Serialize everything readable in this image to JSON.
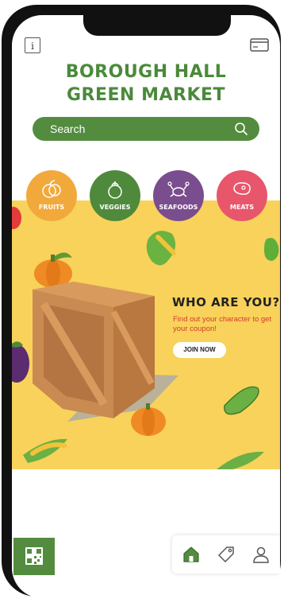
{
  "header": {
    "info_label": "i",
    "title_line1": "BOROUGH HALL",
    "title_line2": "GREEN MARKET",
    "card_icon": "credit-card-icon"
  },
  "search": {
    "placeholder": "Search",
    "icon": "search-icon"
  },
  "categories": [
    {
      "label": "FRUITS",
      "color": "#f2a93b",
      "icon": "fruit-icon"
    },
    {
      "label": "VEGGIES",
      "color": "#4f8a3c",
      "icon": "vegetable-icon"
    },
    {
      "label": "SEAFOODS",
      "color": "#7a4d8e",
      "icon": "crab-icon"
    },
    {
      "label": "MEATS",
      "color": "#e8566c",
      "icon": "steak-icon"
    }
  ],
  "promo": {
    "heading": "WHO ARE YOU?",
    "subtitle": "Find out your character to get your coupon!",
    "button_label": "JOIN NOW",
    "background": "#f8d25b"
  },
  "bottom_nav": {
    "items": [
      {
        "name": "home",
        "icon": "home-icon",
        "active": true
      },
      {
        "name": "tag",
        "icon": "tag-icon",
        "active": false
      },
      {
        "name": "profile",
        "icon": "user-icon",
        "active": false
      }
    ]
  },
  "colors": {
    "brand_green": "#538c3f",
    "title_green": "#4a8a3a"
  }
}
